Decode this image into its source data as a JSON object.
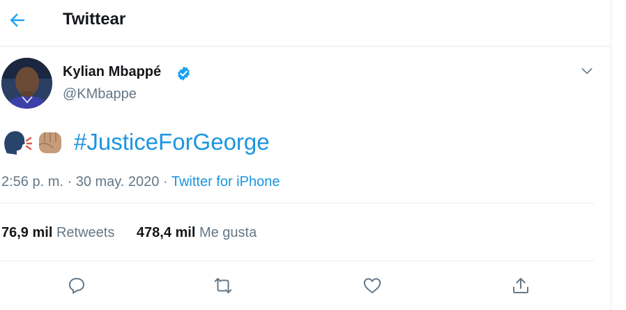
{
  "header": {
    "title": "Twittear"
  },
  "tweet": {
    "author_name": "Kylian Mbappé",
    "author_handle": "@KMbappe",
    "hashtag": "#JusticeForGeorge",
    "time": "2:56 p. m. · 30 may. 2020 · ",
    "source": "Twitter for iPhone",
    "retweets_count": "76,9 mil",
    "retweets_label": " Retweets",
    "likes_count": "478,4 mil",
    "likes_label": " Me gusta"
  },
  "icons": {
    "back": "arrow-left-icon",
    "verified": "verified-badge-icon",
    "menu": "chevron-down-icon",
    "reply": "speech-bubble-icon",
    "retweet": "retweet-icon",
    "like": "heart-icon",
    "share": "share-upload-icon"
  },
  "colors": {
    "accent": "#1b95e0",
    "muted": "#657786",
    "text": "#14171a",
    "border": "#e6ecf0"
  }
}
